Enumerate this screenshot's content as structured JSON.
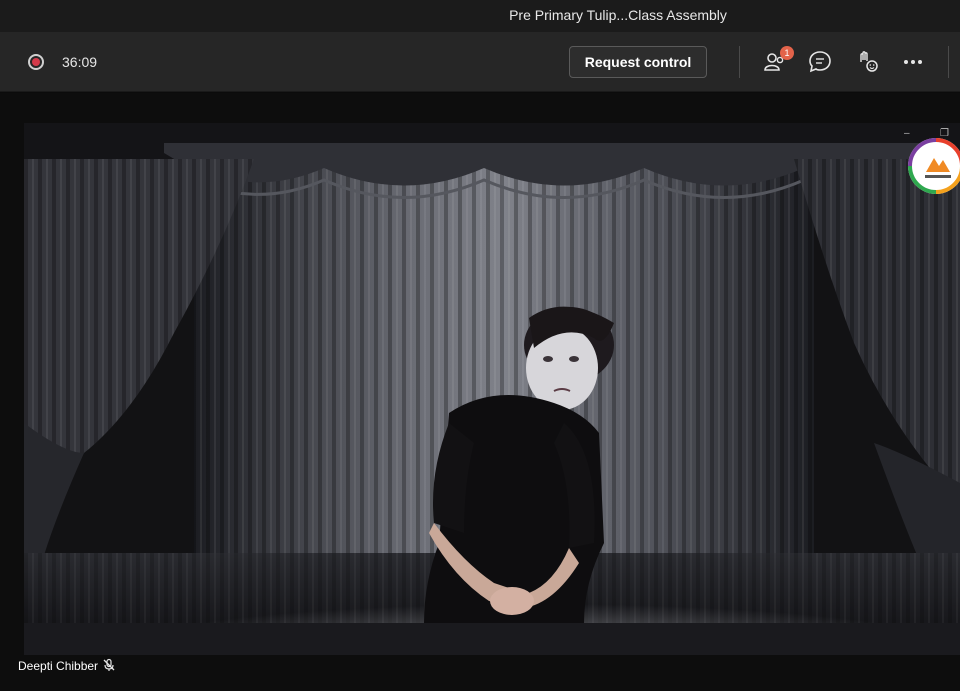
{
  "window": {
    "title": "Pre Primary Tulip...Class Assembly"
  },
  "toolbar": {
    "recording_icon": "record-icon",
    "timer": "36:09",
    "request_control_label": "Request control",
    "participants_badge": "1",
    "icons": [
      "participants-icon",
      "chat-icon",
      "reactions-icon",
      "more-icon"
    ]
  },
  "video": {
    "minimize_glyph": "–",
    "restore_glyph": "❐",
    "participant_name": "Deepti Chibber",
    "mic_state": "muted"
  },
  "colors": {
    "record": "#d33a4a",
    "badge": "#e3634a",
    "toolbar_bg": "#262626"
  }
}
